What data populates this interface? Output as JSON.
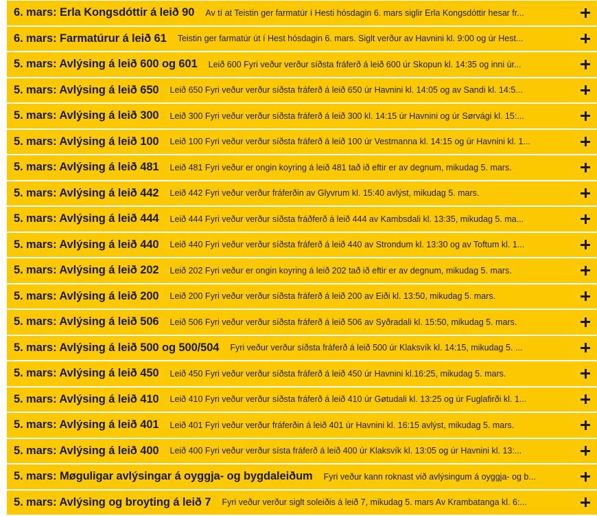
{
  "colors": {
    "accent": "#fcc800",
    "text": "#1a1a1a",
    "background": "#ffffff"
  },
  "expand_icon": "plus-icon",
  "items": [
    {
      "title": "6. mars: Erla Kongsdóttir á leið 90",
      "summary": "Av tí at Teistin ger farmatúr í Hesti hósdagin 6. mars siglir Erla Kongsdóttir hesar fr..."
    },
    {
      "title": "6. mars: Farmatúrur á leið 61",
      "summary": "Teistin ger farmatúr út í Hest hósdagin 6. mars. Siglt verður av Havnini kl. 9:00 og úr Hest..."
    },
    {
      "title": "5. mars: Avlýsing á leið 600 og 601",
      "summary": "Leið 600 Fyri veður verður síðsta fráferð á leið 600 úr Skopun kl. 14:35 og inni úr..."
    },
    {
      "title": "5. mars: Avlýsing á leið 650",
      "summary": "Leið 650 Fyri veður verður síðsta fráferð á leið 650 úr Havnini kl. 14:05 og av Sandi kl. 14:5..."
    },
    {
      "title": "5. mars: Avlýsing á leið 300",
      "summary": "Leið 300 Fyri veður verður síðsta fráferð á leið 300 kl. 14:15 úr Havnini og úr Sørvági kl. 15:..."
    },
    {
      "title": "5. mars: Avlýsing á leið 100",
      "summary": "Leið 100 Fyri veður verður síðsta fráferð á leið 100 úr Vestmanna kl. 14:15 og úr Havnini kl. 1..."
    },
    {
      "title": "5. mars: Avlýsing á leið 481",
      "summary": "Leið 481 Fyri veður er ongin koyring á leið 481 tað ið eftir er av degnum, mikudag 5. mars."
    },
    {
      "title": "5. mars: Avlýsing á leið 442",
      "summary": "Leið 442 Fyri veður verður fráferðin av Glyvrum kl. 15:40 avlýst, mikudag 5. mars."
    },
    {
      "title": "5. mars: Avlýsing á leið 444",
      "summary": "Leið 444 Fyri veður verður síðsta fráðferð á leið 444 av Kambsdali kl. 13:35, mikudag 5. ma..."
    },
    {
      "title": "5. mars: Avlýsing á leið 440",
      "summary": "Leið 440 Fyri veður verður síðsta fráferð á leið 440 av Strondum kl. 13:30 og av Toftum kl. 1..."
    },
    {
      "title": "5. mars: Avlýsing á leið 202",
      "summary": "Leið 202 Fyri veður er ongin koyring á leið 202 tað ið eftir er av degnum, mikudag 5. mars."
    },
    {
      "title": "5. mars: Avlýsing á leið 200",
      "summary": "Leið 200 Fyri veður verður síðsta fráferð á leið 200 av Eiði kl. 13:50, mikudag 5. mars."
    },
    {
      "title": "5. mars: Avlýsing á leið 506",
      "summary": "Leið 506 Fyri veður verður síðsta fráferð á leið 506 av Syðradali kl. 15:50, mikudag 5. mars."
    },
    {
      "title": "5. mars: Avlýsing á leið 500 og 500/504",
      "summary": "Fyri veður verður síðsta fráferð á leið 500 úr Klaksvík kl. 14:15, mikudag 5. ..."
    },
    {
      "title": "5. mars: Avlýsing á leið 450",
      "summary": "Leið 450 Fyri veður verður síðsta fráferð á leið 450 úr Havnini kl.16:25, mikudag 5. mars."
    },
    {
      "title": "5. mars: Avlýsing á leið 410",
      "summary": "Leið 410 Fyri veður verður síðsta fráferð á leið 410 úr Gøtudali kl. 13:25 og úr Fuglafirði kl. 1..."
    },
    {
      "title": "5. mars: Avlýsing á leið 401",
      "summary": "Leið 401 Fyri veður verður fráferðin á leið 401 úr Havnini kl. 16:15 avlýst, mikudag 5. mars."
    },
    {
      "title": "5. mars: Avlýsing á leið 400",
      "summary": "Leið 400 Fyri veður verður sísta fráferð á leið 400 úr Klaksvík kl. 13:05 og úr Havnini kl. 13:..."
    },
    {
      "title": "5. mars: Møguligar avlýsingar á oyggja- og bygdaleiðum",
      "summary": "Fyri veður kann roknast við avlýsingum á oyggja- og b..."
    },
    {
      "title": "5. mars: Avlýsing og broyting á leið 7",
      "summary": "Fyri veður verður siglt soleiðis á leið 7, mikudag 5. mars Av Krambatanga kl. 6:..."
    }
  ]
}
